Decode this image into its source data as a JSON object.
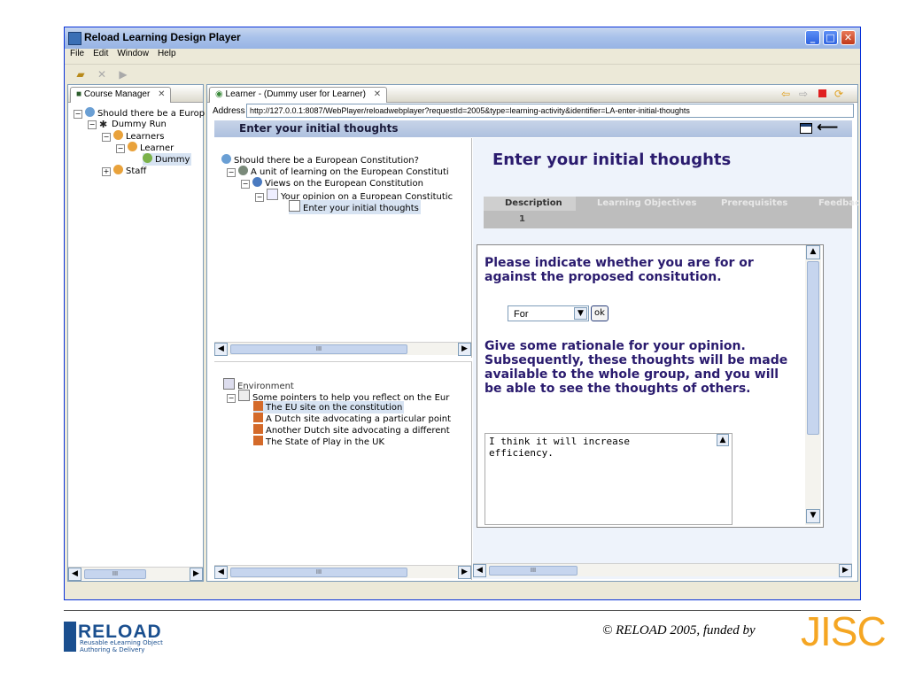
{
  "window": {
    "title": "Reload Learning Design Player",
    "controls": {
      "minimize": "_",
      "maximize": "□",
      "close": "✕"
    }
  },
  "menu": [
    "File",
    "Edit",
    "Window",
    "Help"
  ],
  "course_manager": {
    "tab_label": "Course Manager",
    "tab_close": "✕",
    "tree": [
      {
        "label": "Should there be a Europ"
      },
      {
        "label": "Dummy Run"
      },
      {
        "label": "Learners"
      },
      {
        "label": "Learner"
      },
      {
        "label": "Dummy"
      },
      {
        "label": "Staff"
      }
    ]
  },
  "learner_view": {
    "tab_label": "Learner - (Dummy user for Learner)",
    "tab_close": "✕",
    "address_label": "Address",
    "address_value": "http://127.0.0.1:8087/WebPlayer/reloadwebplayer?requestId=2005&type=learning-activity&identifier=LA-enter-initial-thoughts",
    "header_title": "Enter your initial thoughts",
    "nav_icons": [
      "back-arrow-icon",
      "forward-arrow-icon",
      "stop-icon",
      "refresh-icon"
    ]
  },
  "activity_tree": {
    "items": [
      "Should there be a European Constitution?",
      "A unit of learning on the European Constituti",
      "Views on the European Constitution",
      "Your opinion on a European Constitutic",
      "Enter your initial thoughts"
    ]
  },
  "environment": {
    "title": "Environment",
    "items": [
      "Some pointers to help you reflect on the Eur",
      "The EU site on the constitution",
      "A Dutch site advocating a particular point",
      "Another Dutch site advocating a different",
      "The State of Play in the UK"
    ]
  },
  "content": {
    "title": "Enter your initial thoughts",
    "tabs": [
      "Description",
      "Learning Objectives",
      "Prerequisites",
      "Feedbac"
    ],
    "tab_row_value": "1",
    "question1": "Please indicate whether you are for or against the proposed consitution.",
    "select_value": "For",
    "ok_label": "ok",
    "question2": "Give some rationale for your opinion. Subsequently, these thoughts will be made available to the whole group, and you will be able to see the thoughts of others.",
    "textarea_value": "I think it will increase\nefficiency."
  },
  "scrollbar_thumb_text": "III",
  "footer": {
    "logo_text": "RELOAD",
    "logo_sub1": "Reusable eLearning Object",
    "logo_sub2": "Authoring & Delivery",
    "copyright": "© RELOAD 2005, funded by",
    "jisc": "JISC"
  },
  "colors": {
    "purple_text": "#2a1b6e",
    "jisc_orange": "#f5a623",
    "reload_blue": "#1a4f8f"
  }
}
